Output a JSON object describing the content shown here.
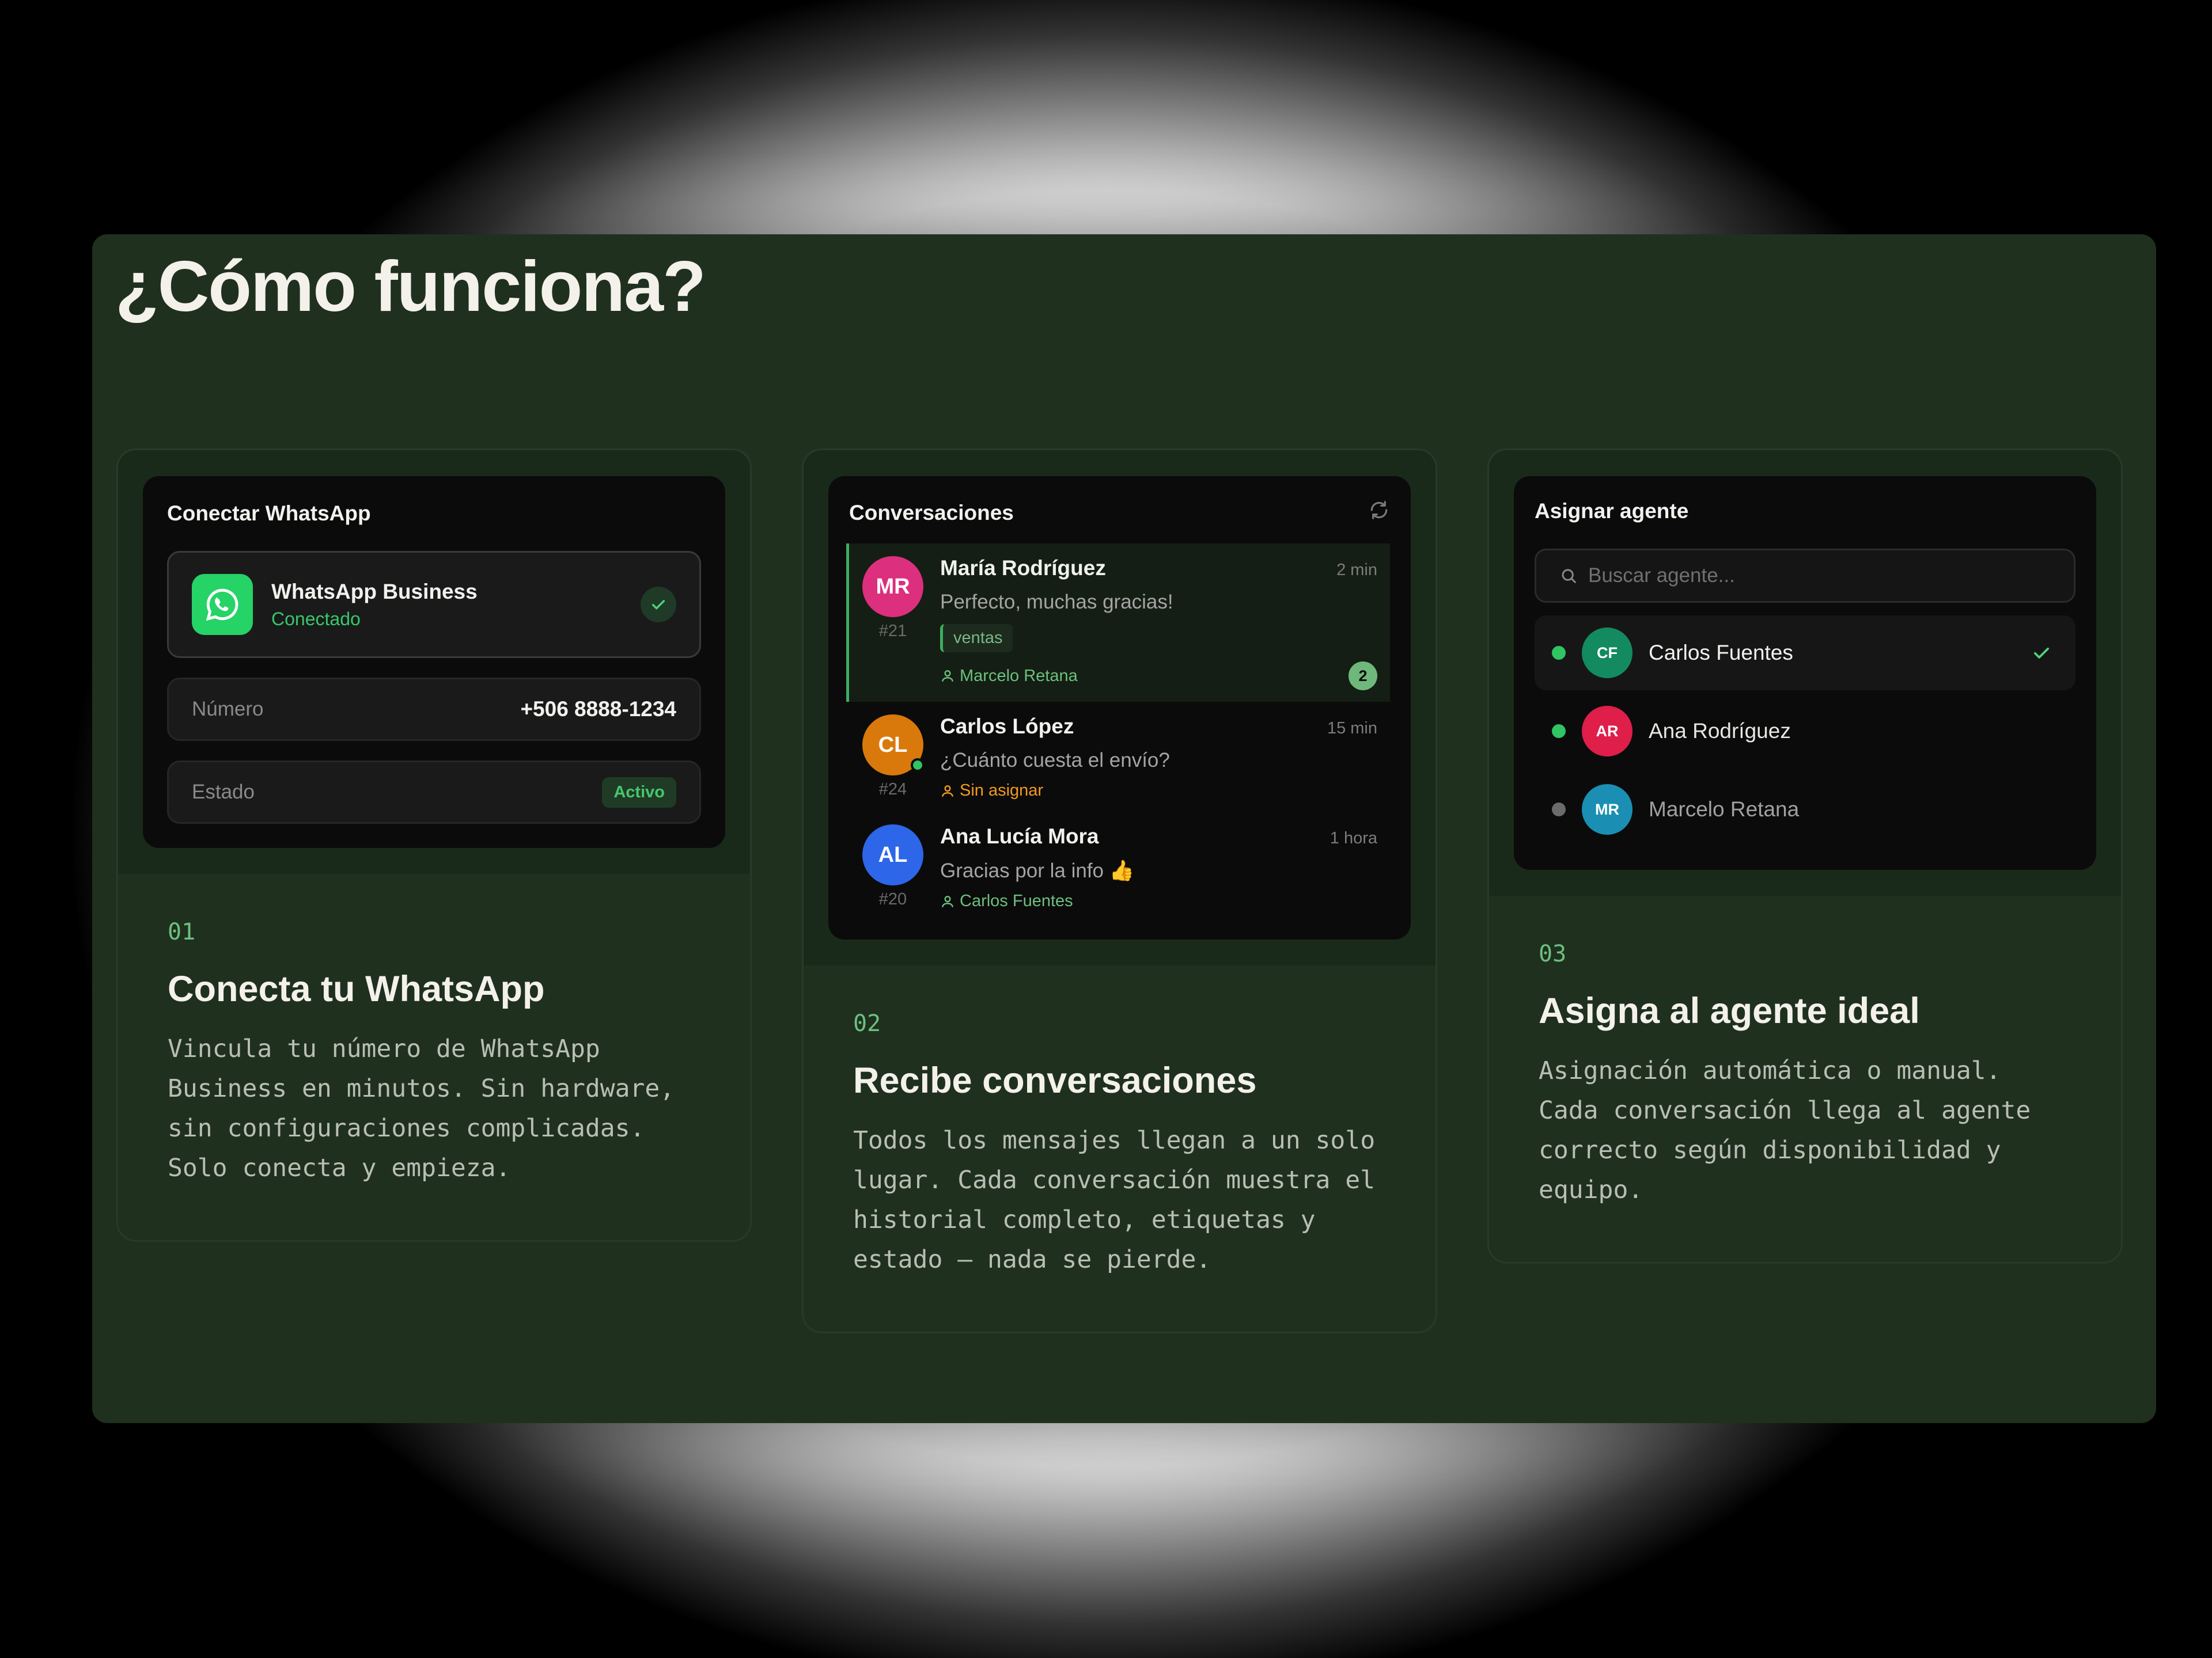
{
  "page": {
    "title": "¿Cómo funciona?"
  },
  "step1": {
    "mock_title": "Conectar WhatsApp",
    "card_name": "WhatsApp Business",
    "card_status": "Conectado",
    "number_label": "Número",
    "number_value": "+506 8888-1234",
    "state_label": "Estado",
    "state_value": "Activo",
    "num": "01",
    "title": "Conecta tu WhatsApp",
    "desc": "Vincula tu número de WhatsApp Business en minutos. Sin hardware, sin configuraciones complicadas. Solo conecta y empieza."
  },
  "step2": {
    "mock_title": "Conversaciones",
    "conversations": [
      {
        "initials": "MR",
        "id": "#21",
        "name": "María Rodríguez",
        "time": "2 min",
        "message": "Perfecto, muchas gracias!",
        "tag": "ventas",
        "agent": "Marcelo Retana",
        "unread": "2",
        "color": "#dc2f7e",
        "agent_color": "#6cc07e"
      },
      {
        "initials": "CL",
        "id": "#24",
        "name": "Carlos López",
        "time": "15 min",
        "message": "¿Cuánto cuesta el envío?",
        "agent": "Sin asignar",
        "color": "#d9790c",
        "agent_color": "#f29a1f"
      },
      {
        "initials": "AL",
        "id": "#20",
        "name": "Ana Lucía Mora",
        "time": "1 hora",
        "message": "Gracias por la info 👍",
        "agent": "Carlos Fuentes",
        "color": "#2d66e8",
        "agent_color": "#6cc07e"
      }
    ],
    "num": "02",
    "title": "Recibe conversaciones",
    "desc": "Todos los mensajes llegan a un solo lugar. Cada conversación muestra el historial completo, etiquetas y estado — nada se pierde."
  },
  "step3": {
    "mock_title": "Asignar agente",
    "search_placeholder": "Buscar agente...",
    "agents": [
      {
        "initials": "CF",
        "name": "Carlos Fuentes",
        "color": "#138a5f",
        "status_color": "#30c463",
        "text_color": "#f1f1ee"
      },
      {
        "initials": "AR",
        "name": "Ana Rodríguez",
        "color": "#df1e4a",
        "status_color": "#30c463",
        "text_color": "#e6e6e2"
      },
      {
        "initials": "MR",
        "name": "Marcelo Retana",
        "color": "#1a8fb3",
        "status_color": "#6b6b6b",
        "text_color": "#a0a0a0"
      }
    ],
    "num": "03",
    "title": "Asigna al agente ideal",
    "desc": "Asignación automática o manual. Cada conversación llega al agente correcto según disponibilidad y equipo."
  }
}
